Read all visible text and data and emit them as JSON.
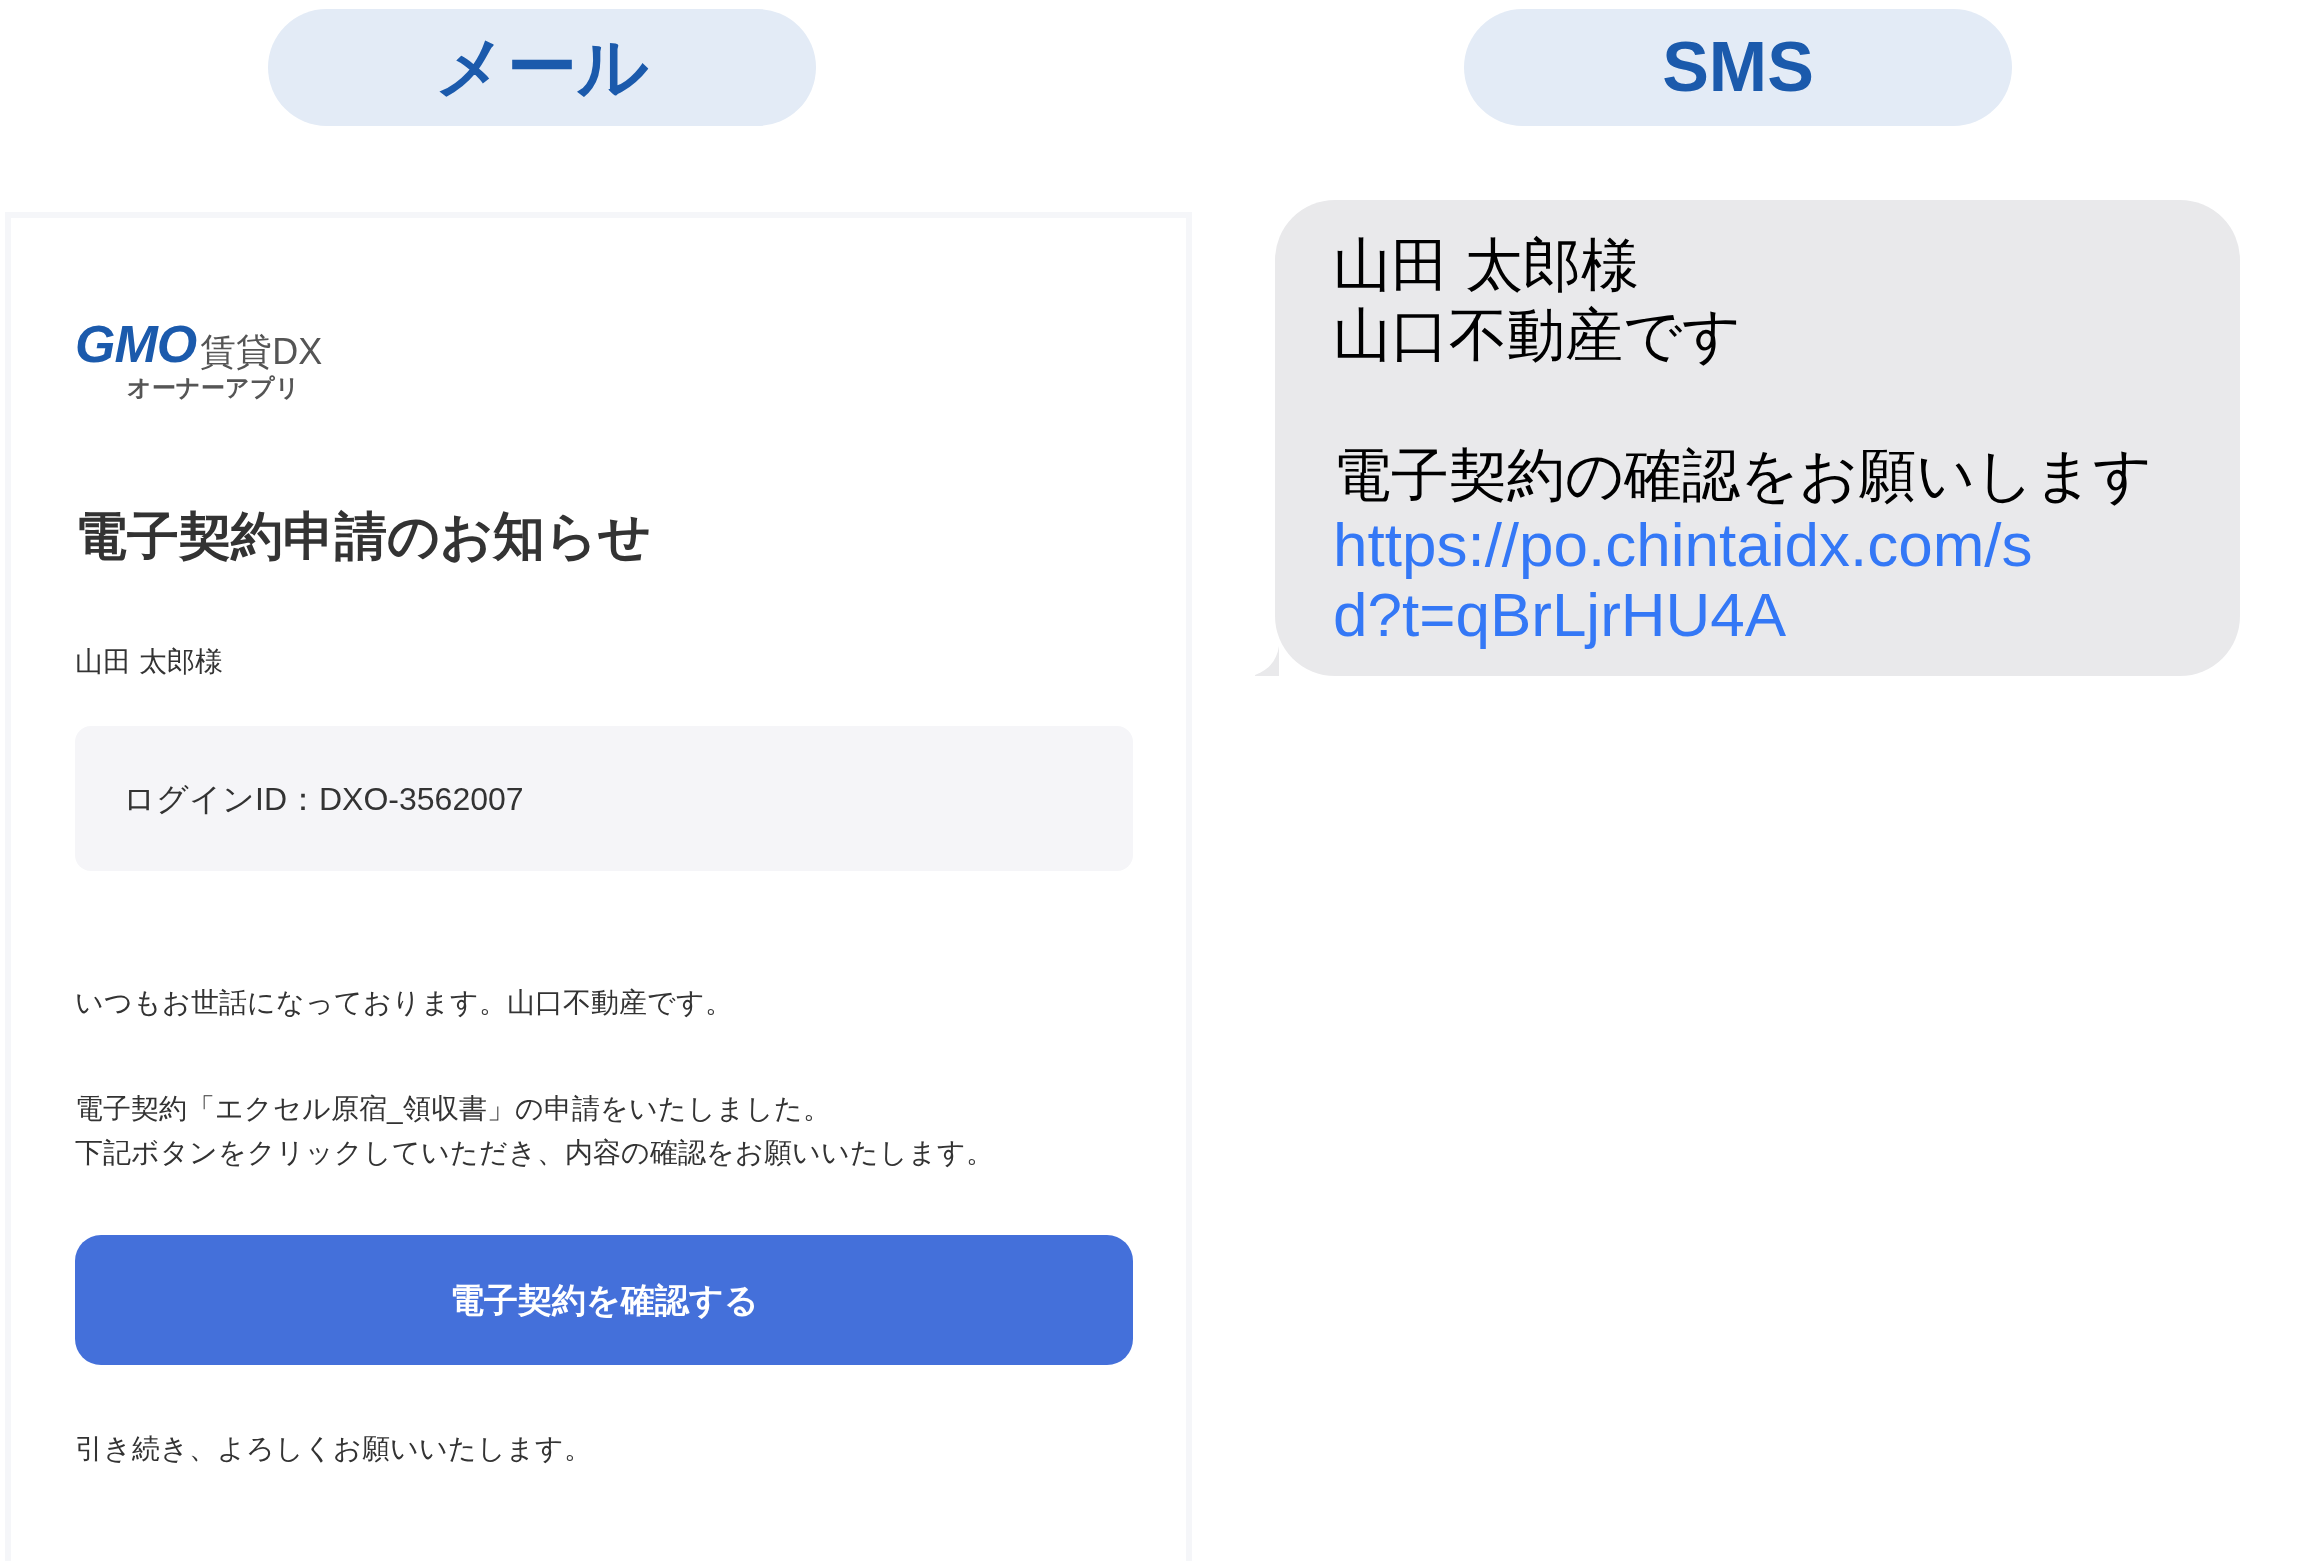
{
  "columns": [
    {
      "label": "メール",
      "email": {
        "logo": {
          "brand": "GMO",
          "product": "賃貸DX",
          "subtitle": "オーナーアプリ"
        },
        "title": "電子契約申請のお知らせ",
        "recipient": "山田 太郎様",
        "login_id": "ログインID：DXO-3562007",
        "paragraphs": [
          [
            "いつもお世話になっております。山口不動産です。"
          ],
          [
            "電子契約「エクセル原宿_領収書」の申請をいたしました。",
            "下記ボタンをクリックしていただき、内容の確認をお願いいたします。"
          ]
        ],
        "button": "電子契約を確認する",
        "closing": "引き続き、よろしくお願いいたします。"
      }
    },
    {
      "label": "SMS",
      "sms": {
        "lines": [
          "山田 太郎様",
          "山口不動産です"
        ],
        "message": "電子契約の確認をお願いします",
        "link": "https://po.chintaidx.com/sd?t=qBrLjrHU4A"
      }
    }
  ]
}
